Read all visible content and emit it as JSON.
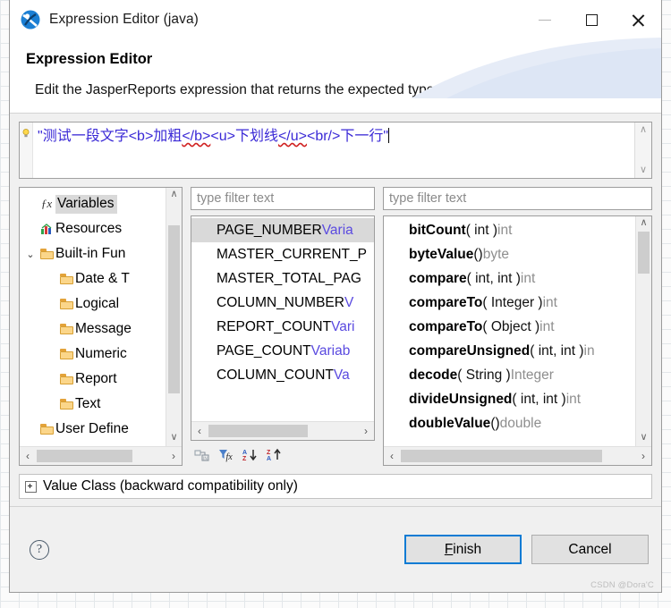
{
  "window": {
    "title": "Expression Editor (java)",
    "app_icon": "jaspersoft-logo-icon",
    "minimize_label": "—",
    "maximize_label": "□",
    "close_label": "✕"
  },
  "header": {
    "title": "Expression Editor",
    "description": "Edit the JasperReports expression that returns the expected type."
  },
  "expression": {
    "quote_open": "\"",
    "segments": [
      {
        "text": "测试一段文字",
        "squiggly": false
      },
      {
        "text": "<b>",
        "squiggly": false
      },
      {
        "text": "加粗",
        "squiggly": false
      },
      {
        "text": "</b>",
        "squiggly": true
      },
      {
        "text": "<u>",
        "squiggly": false
      },
      {
        "text": "下划线",
        "squiggly": false
      },
      {
        "text": "</u>",
        "squiggly": true
      },
      {
        "text": "<br/>",
        "squiggly": false
      },
      {
        "text": "下一行",
        "squiggly": false
      }
    ],
    "full_text": "\"测试一段文字<b>加粗</b><u>下划线</u><br/>下一行\"",
    "quote_close": "\"",
    "gutter_icon": "lightbulb-hint-icon",
    "text_color": "#3a29d6",
    "error_underline_color": "#d02020",
    "scroll_up_icon": "∧",
    "scroll_down_icon": "∨"
  },
  "tree": {
    "items": [
      {
        "label": "Variables",
        "icon": "fx-icon",
        "indent": 1,
        "twisty": "",
        "selected": true
      },
      {
        "label": "Resources",
        "icon": "resource-icon",
        "indent": 1,
        "twisty": "",
        "selected": false
      },
      {
        "label": "Built-in Fun",
        "icon": "folder-icon",
        "indent": 1,
        "twisty": "⌄",
        "selected": false
      },
      {
        "label": "Date & T",
        "icon": "folder-icon",
        "indent": 2,
        "twisty": "",
        "selected": false
      },
      {
        "label": "Logical",
        "icon": "folder-icon",
        "indent": 2,
        "twisty": "",
        "selected": false
      },
      {
        "label": "Message",
        "icon": "folder-icon",
        "indent": 2,
        "twisty": "",
        "selected": false
      },
      {
        "label": "Numeric",
        "icon": "folder-icon",
        "indent": 2,
        "twisty": "",
        "selected": false
      },
      {
        "label": "Report",
        "icon": "folder-icon",
        "indent": 2,
        "twisty": "",
        "selected": false
      },
      {
        "label": "Text",
        "icon": "folder-icon",
        "indent": 2,
        "twisty": "",
        "selected": false
      },
      {
        "label": "User Define",
        "icon": "folder-icon",
        "indent": 1,
        "twisty": "",
        "selected": false
      }
    ],
    "scroll_up_icon": "∧",
    "scroll_down_icon": "∨",
    "scroll_left_icon": "‹",
    "scroll_right_icon": "›"
  },
  "middle": {
    "filter_placeholder": "type filter text",
    "items": [
      {
        "name": "PAGE_NUMBER",
        "type": "Varia",
        "selected": true
      },
      {
        "name": "MASTER_CURRENT_P",
        "type": "",
        "selected": false
      },
      {
        "name": "MASTER_TOTAL_PAG",
        "type": "",
        "selected": false
      },
      {
        "name": "COLUMN_NUMBER",
        "type": "V",
        "selected": false
      },
      {
        "name": "REPORT_COUNT",
        "type": "Vari",
        "selected": false
      },
      {
        "name": "PAGE_COUNT",
        "type": "Variab",
        "selected": false
      },
      {
        "name": "COLUMN_COUNT",
        "type": "Va",
        "selected": false
      }
    ],
    "toolbar": [
      {
        "icon": "insert-into-expression-icon"
      },
      {
        "icon": "filter-functions-icon"
      },
      {
        "icon": "sort-az-descending-icon"
      },
      {
        "icon": "sort-za-ascending-icon"
      }
    ],
    "scroll_left_icon": "‹",
    "scroll_right_icon": "›"
  },
  "right": {
    "filter_placeholder": "type filter text",
    "methods": [
      {
        "name": "bitCount",
        "params": "( int )",
        "ret": "int"
      },
      {
        "name": "byteValue",
        "params": "()",
        "ret": "byte"
      },
      {
        "name": "compare",
        "params": "( int, int )",
        "ret": "int"
      },
      {
        "name": "compareTo",
        "params": "( Integer )",
        "ret": "int"
      },
      {
        "name": "compareTo",
        "params": "( Object )",
        "ret": "int"
      },
      {
        "name": "compareUnsigned",
        "params": "( int, int )",
        "ret": "in"
      },
      {
        "name": "decode",
        "params": "( String )",
        "ret": "Integer"
      },
      {
        "name": "divideUnsigned",
        "params": "( int, int )",
        "ret": "int"
      },
      {
        "name": "doubleValue",
        "params": "()",
        "ret": "double"
      }
    ],
    "scroll_up_icon": "∧",
    "scroll_down_icon": "∨",
    "scroll_left_icon": "‹",
    "scroll_right_icon": "›"
  },
  "value_class": {
    "label": "Value Class (backward compatibility only)",
    "expanded": false
  },
  "footer": {
    "help_icon": "help-question-icon",
    "finish_prefix": "",
    "finish_accel": "F",
    "finish_suffix": "inish",
    "cancel_label": "Cancel",
    "watermark": "CSDN @Dora'C"
  }
}
